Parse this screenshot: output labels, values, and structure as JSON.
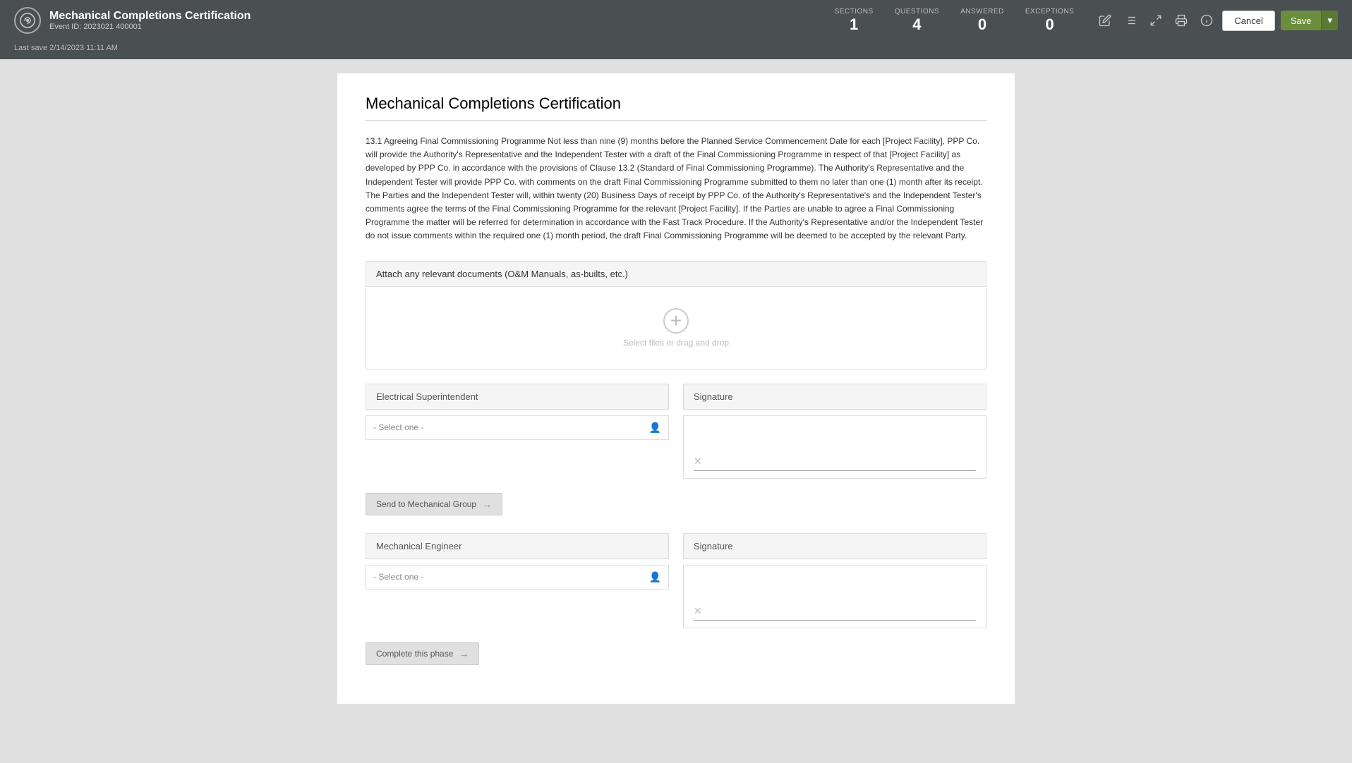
{
  "header": {
    "logo_icon": "circle-logo",
    "title": "Mechanical Completions Certification",
    "event_id_label": "Event ID:",
    "event_id": "2023021 400001",
    "sections_label": "SECTIONS",
    "sections_value": "1",
    "questions_label": "QUESTIONS",
    "questions_value": "4",
    "answered_label": "ANSWERED",
    "answered_value": "0",
    "exceptions_label": "EXCEPTIONS",
    "exceptions_value": "0",
    "last_save_text": "Last save 2/14/2023 11:11 AM",
    "cancel_label": "Cancel",
    "save_label": "Save"
  },
  "toolbar": {
    "edit_icon": "edit-icon",
    "list_icon": "list-icon",
    "expand_icon": "expand-icon",
    "print_icon": "print-icon",
    "info_icon": "info-icon"
  },
  "main": {
    "page_title": "Mechanical Completions Certification",
    "body_text": "13.1 Agreeing Final Commissioning Programme Not less than nine (9) months before the Planned Service Commencement Date for each [Project Facility], PPP Co. will provide the Authority's Representative and the Independent Tester with a draft of the Final Commissioning Programme in respect of that [Project Facility] as developed by PPP Co. in accordance with the provisions of Clause 13.2 (Standard of Final Commissioning Programme). The Authority's Representative and the Independent Tester will provide PPP Co. with comments on the draft Final Commissioning Programme submitted to them no later than one (1) month after its receipt. The Parties and the Independent Tester will, within twenty (20) Business Days of receipt by PPP Co. of the Authority's Representative's and the Independent Tester's comments agree the terms of the Final Commissioning Programme for the relevant [Project Facility]. If the Parties are unable to agree a Final Commissioning Programme the matter will be referred for determination in accordance with the Fast Track Procedure. If the Authority's Representative and/or the Independent Tester do not issue comments within the required one (1) month period, the draft Final Commissioning Programme will be deemed to be accepted by the relevant Party.",
    "attach_label": "Attach any relevant documents (O&M Manuals, as-builts, etc.)",
    "dropzone_text": "Select files or drag and drop",
    "electrical_super_label": "Electrical Superintendent",
    "mechanical_engineer_label": "Mechanical Engineer",
    "signature_label_1": "Signature",
    "signature_label_2": "Signature",
    "select_one_placeholder": "- Select one -",
    "send_btn_label": "Send to Mechanical Group",
    "complete_btn_label": "Complete this phase",
    "send_arrow": "→",
    "complete_arrow": "→"
  }
}
